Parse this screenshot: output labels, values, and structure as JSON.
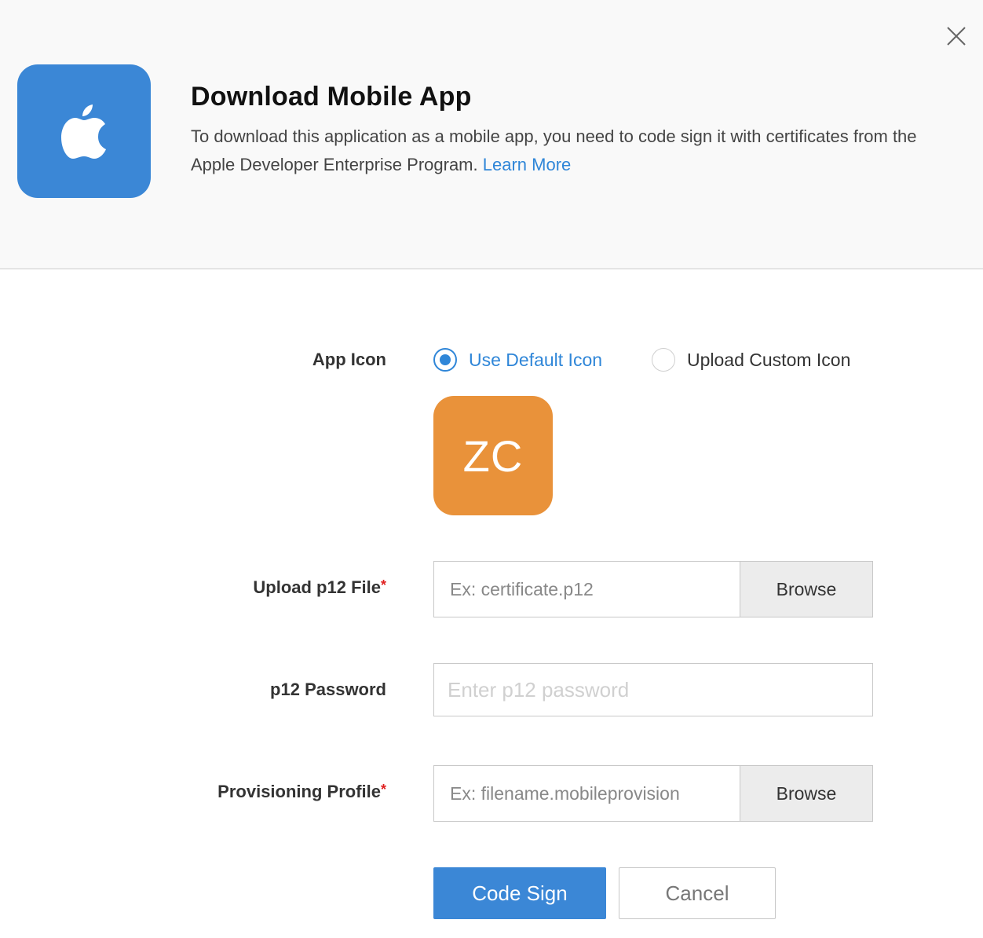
{
  "header": {
    "title": "Download Mobile App",
    "description": "To download this application as a mobile app, you need to code sign it with certificates from the Apple Developer Enterprise Program.",
    "learn_more": "Learn More",
    "brand_color": "#3b87d6",
    "icon": "apple-icon"
  },
  "close": {
    "icon": "close-icon"
  },
  "app_icon": {
    "label": "App Icon",
    "options": [
      {
        "label": "Use Default Icon",
        "selected": true
      },
      {
        "label": "Upload Custom Icon",
        "selected": false
      }
    ],
    "default_icon_text": "ZC",
    "default_icon_color": "#e9923a"
  },
  "p12_file": {
    "label": "Upload p12 File",
    "required_mark": "*",
    "placeholder": "Ex: certificate.p12",
    "browse_label": "Browse"
  },
  "p12_password": {
    "label": "p12 Password",
    "placeholder": "Enter p12 password"
  },
  "provisioning": {
    "label": "Provisioning Profile",
    "required_mark": "*",
    "placeholder": "Ex: filename.mobileprovision",
    "browse_label": "Browse"
  },
  "actions": {
    "primary": "Code Sign",
    "secondary": "Cancel"
  }
}
